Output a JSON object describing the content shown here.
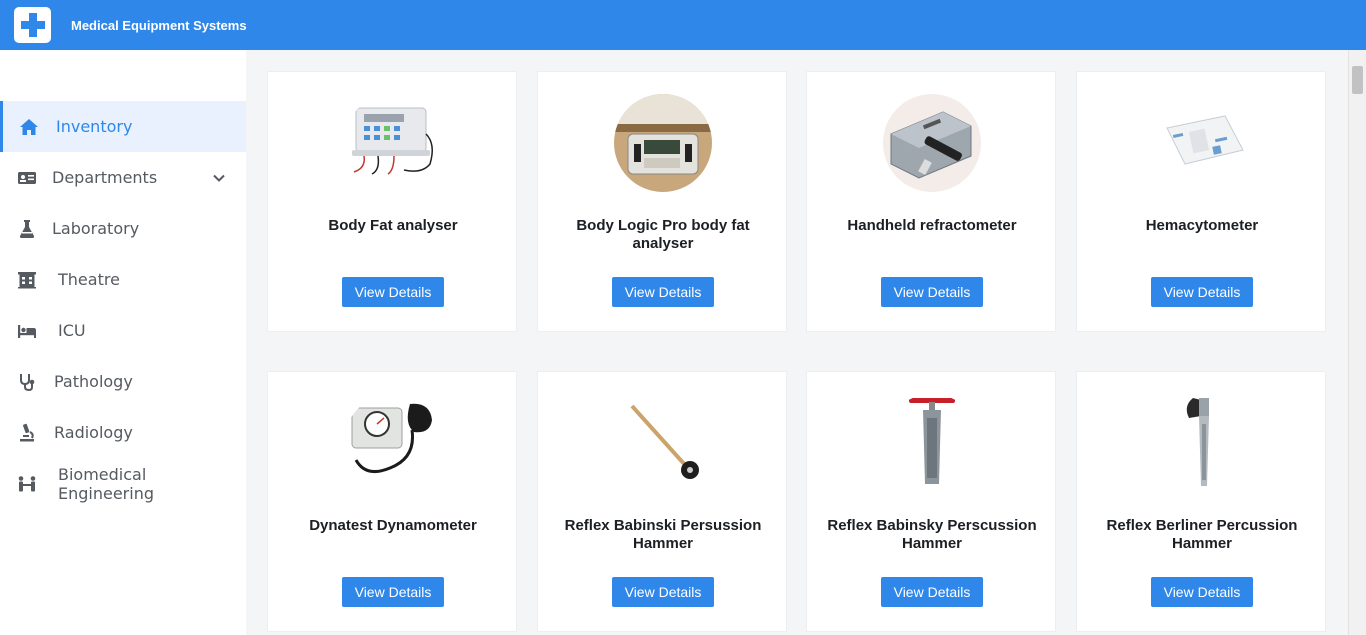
{
  "header": {
    "title": "Medical Equipment Systems",
    "logo_icon": "medical-cross-icon",
    "brand_color": "#2f87ea"
  },
  "sidebar": {
    "items": [
      {
        "label": "Inventory",
        "icon": "home-icon",
        "active": true
      },
      {
        "label": "Departments",
        "icon": "id-card-icon",
        "has_dropdown": true
      },
      {
        "label": "Laboratory",
        "icon": "flask-icon"
      },
      {
        "label": "Theatre",
        "icon": "building-icon"
      },
      {
        "label": "ICU",
        "icon": "bed-icon"
      },
      {
        "label": "Pathology",
        "icon": "stethoscope-icon"
      },
      {
        "label": "Radiology",
        "icon": "microscope-icon"
      },
      {
        "label": "Biomedical Engineering",
        "icon": "people-icon"
      }
    ]
  },
  "equipment": [
    {
      "name": "Body Fat analyser",
      "button": "View Details"
    },
    {
      "name": "Body Logic Pro body fat analyser",
      "button": "View Details"
    },
    {
      "name": "Handheld refractometer",
      "button": "View Details"
    },
    {
      "name": "Hemacytometer",
      "button": "View Details"
    },
    {
      "name": "Dynatest Dynamometer",
      "button": "View Details"
    },
    {
      "name": "Reflex Babinski Persussion Hammer",
      "button": "View Details"
    },
    {
      "name": "Reflex Babinsky Perscussion Hammer",
      "button": "View Details"
    },
    {
      "name": "Reflex Berliner Percussion Hammer",
      "button": "View Details"
    }
  ]
}
